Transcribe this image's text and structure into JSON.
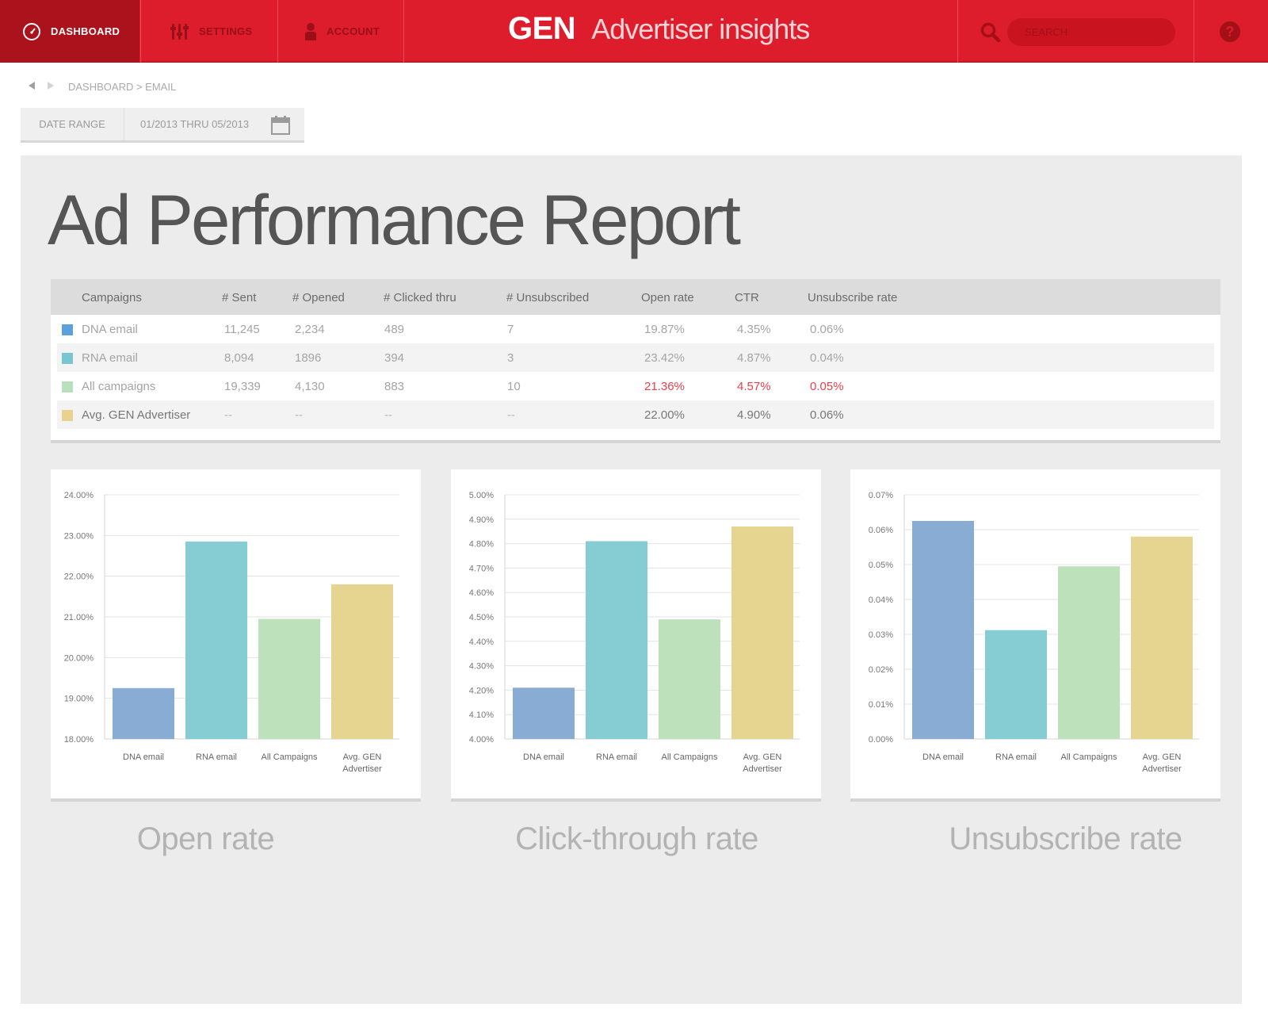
{
  "nav": {
    "dashboard": "DASHBOARD",
    "settings": "SETTINGS",
    "account": "ACCOUNT",
    "brand_gen": "GEN",
    "brand_sub": "Advertiser insights",
    "search_placeholder": "SEARCH"
  },
  "breadcrumb": "DASHBOARD > EMAIL",
  "date_range": {
    "label": "DATE RANGE",
    "value": "01/2013 THRU 05/2013"
  },
  "report_title": "Ad Performance Report",
  "table": {
    "headers": [
      "Campaigns",
      "# Sent",
      "# Opened",
      "# Clicked thru",
      "# Unsubscribed",
      "Open rate",
      "CTR",
      "Unsubscribe rate"
    ],
    "rows": [
      {
        "name": "DNA email",
        "color": "#5aa3d9",
        "sent": "11,245",
        "opened": "2,234",
        "clicked": "489",
        "unsub": "7",
        "open_rate": "19.87%",
        "ctr": "4.35%",
        "unsub_rate": "0.06%"
      },
      {
        "name": "RNA email",
        "color": "#77c6d2",
        "sent": "8,094",
        "opened": "1896",
        "clicked": "394",
        "unsub": "3",
        "open_rate": "23.42%",
        "ctr": "4.87%",
        "unsub_rate": "0.04%"
      },
      {
        "name": "All campaigns",
        "color": "#b9e0bd",
        "sent": "19,339",
        "opened": "4,130",
        "clicked": "883",
        "unsub": "10",
        "open_rate": "21.36%",
        "ctr": "4.57%",
        "unsub_rate": "0.05%"
      },
      {
        "name": "Avg. GEN Advertiser",
        "color": "#e8d28e",
        "sent": "--",
        "opened": "--",
        "clicked": "--",
        "unsub": "--",
        "open_rate": "22.00%",
        "ctr": "4.90%",
        "unsub_rate": "0.06%"
      }
    ]
  },
  "chart_data": [
    {
      "type": "bar",
      "title": "Open rate",
      "categories": [
        "DNA email",
        "RNA email",
        "All Campaigns",
        "Avg. GEN Advertiser"
      ],
      "values": [
        19.25,
        22.85,
        20.95,
        21.8
      ],
      "colors": [
        "#88acd3",
        "#85cdd3",
        "#bde2bb",
        "#e6d590"
      ],
      "ylim": [
        18,
        24
      ],
      "yticks": [
        "24.00%",
        "23.00%",
        "22.00%",
        "21.00%",
        "20.00%",
        "19.00%",
        "18.00%"
      ],
      "grid": true
    },
    {
      "type": "bar",
      "title": "Click-through rate",
      "categories": [
        "DNA email",
        "RNA email",
        "All Campaigns",
        "Avg. GEN Advertiser"
      ],
      "values": [
        4.21,
        4.81,
        4.49,
        4.87
      ],
      "colors": [
        "#88acd3",
        "#85cdd3",
        "#bde2bb",
        "#e6d590"
      ],
      "ylim": [
        4.0,
        5.0
      ],
      "yticks": [
        "5.00%",
        "4.90%",
        "4.80%",
        "4.70%",
        "4.60%",
        "4.50%",
        "4.40%",
        "4.30%",
        "4.20%",
        "4.10%",
        "4.00%"
      ],
      "grid": true
    },
    {
      "type": "bar",
      "title": "Unsubscribe rate",
      "categories": [
        "DNA email",
        "RNA email",
        "All Campaigns",
        "Avg. GEN Advertiser"
      ],
      "values": [
        0.0625,
        0.0312,
        0.0495,
        0.058
      ],
      "colors": [
        "#88acd3",
        "#85cdd3",
        "#bde2bb",
        "#e6d590"
      ],
      "ylim": [
        0,
        0.07
      ],
      "yticks": [
        "0.07%",
        "0.06%",
        "0.05%",
        "0.04%",
        "0.03%",
        "0.02%",
        "0.01%",
        "0.00%"
      ],
      "grid": true
    }
  ]
}
